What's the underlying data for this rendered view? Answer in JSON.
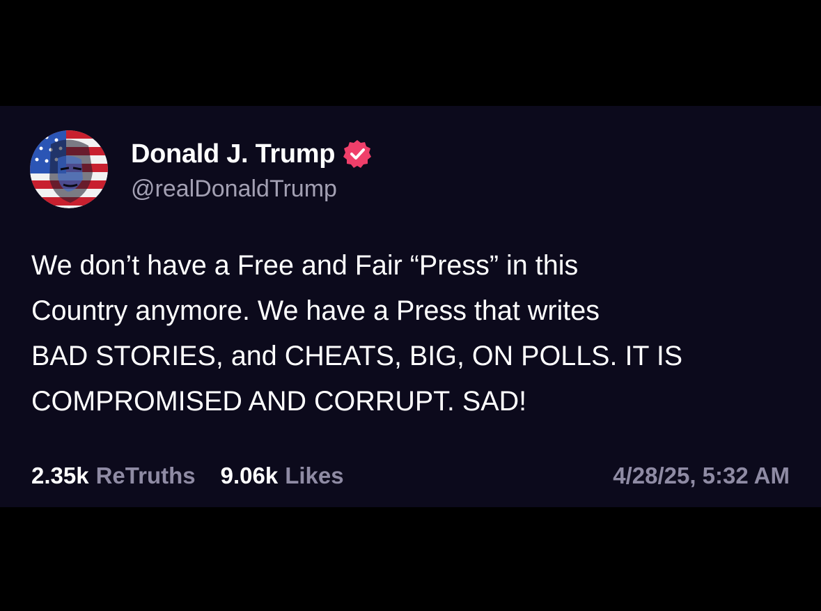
{
  "post": {
    "author": {
      "display_name": "Donald J. Trump",
      "handle": "@realDonaldTrump",
      "avatar_icon": "flag-portrait-avatar",
      "verified_icon": "verified-badge-icon",
      "verified_color": "#ef3f6a"
    },
    "text_lines": [
      "We don’t have a Free and Fair “Press” in this",
      "Country anymore. We have a Press that writes",
      "BAD STORIES, and CHEATS, BIG, ON POLLS. IT IS",
      "COMPROMISED AND CORRUPT. SAD!"
    ],
    "stats": {
      "retruths_count": "2.35k",
      "retruths_label": "ReTruths",
      "likes_count": "9.06k",
      "likes_label": "Likes"
    },
    "timestamp": "4/28/25, 5:32 AM"
  },
  "colors": {
    "card_background": "#0c0a1c",
    "page_background": "#000000",
    "muted_text": "#8f8ba4"
  }
}
